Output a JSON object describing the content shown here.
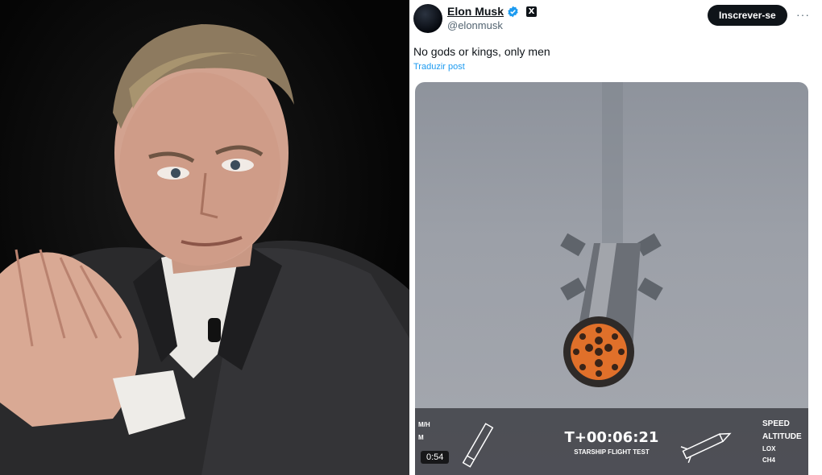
{
  "tweet": {
    "author_name": "Elon Musk",
    "handle": "@elonmusk",
    "subscribe_label": "Inscrever-se",
    "more_label": "···",
    "text": "No gods or kings, only men",
    "translate_label": "Traduzir post",
    "x_badge": "X"
  },
  "video": {
    "clock": "T+00:06:21",
    "subtitle": "STARSHIP FLIGHT TEST",
    "left_labels": [
      "M/H",
      "M"
    ],
    "right_labels": [
      "SPEED",
      "ALTITUDE"
    ],
    "right_small_labels": [
      "LOX",
      "CH4"
    ],
    "duration": "0:54"
  },
  "colors": {
    "verified_blue": "#1d9bf0",
    "button_dark": "#0f1419",
    "link_blue": "#1d9bf0",
    "engine_glow": "#e0702a"
  },
  "icons": [
    "verified-icon",
    "x-logo-icon",
    "more-icon"
  ]
}
